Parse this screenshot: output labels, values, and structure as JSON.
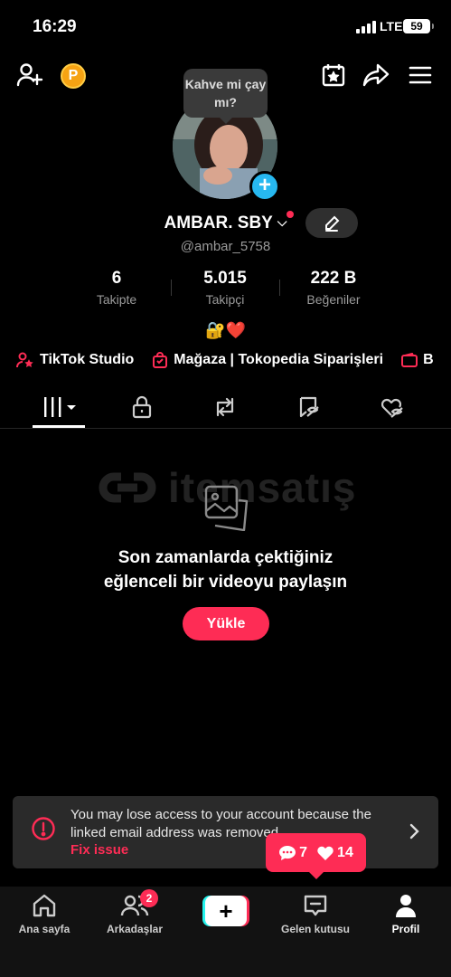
{
  "status_bar": {
    "time": "16:29",
    "network": "LTE",
    "battery": "59"
  },
  "top_bar": {
    "coin_label": "P",
    "icons": [
      "add-friend-icon",
      "coin-icon",
      "calendar-star-icon",
      "share-icon",
      "menu-icon"
    ]
  },
  "profile": {
    "bubble_text": "Kahve mi çay mı?",
    "name": "AMBAR. SBY",
    "handle": "@ambar_5758",
    "stats": [
      {
        "value": "6",
        "label": "Takipte"
      },
      {
        "value": "5.015",
        "label": "Takipçi"
      },
      {
        "value": "222 B",
        "label": "Beğeniler"
      }
    ],
    "bio": "🔐❤️",
    "links": [
      {
        "label": "TikTok Studio",
        "icon": "person-star-icon"
      },
      {
        "label": "Mağaza | Tokopedia Siparişleri",
        "icon": "shopping-bag-icon"
      },
      {
        "label": "B",
        "icon": "wallet-icon"
      }
    ]
  },
  "tabs": [
    "videos-grid-tab",
    "private-tab",
    "repost-tab",
    "favorites-tab",
    "liked-tab"
  ],
  "empty_state": {
    "watermark": "itemsatış",
    "message": "Son zamanlarda çektiğiniz eğlenceli bir videoyu paylaşın",
    "button": "Yükle"
  },
  "banner": {
    "text": "You may lose access to your account because the linked email address was removed.",
    "action": "Fix issue"
  },
  "notification": {
    "comments": "7",
    "likes": "14"
  },
  "nav": {
    "items": [
      {
        "label": "Ana sayfa",
        "icon": "home-icon"
      },
      {
        "label": "Arkadaşlar",
        "icon": "friends-icon"
      },
      {
        "label": "",
        "icon": "create-icon"
      },
      {
        "label": "Gelen kutusu",
        "icon": "inbox-icon"
      },
      {
        "label": "Profil",
        "icon": "profile-icon"
      }
    ],
    "friends_badge": "2"
  },
  "colors": {
    "accent": "#fe2c55",
    "cyan": "#25f4ee",
    "badge_blue": "#27b8f0"
  }
}
